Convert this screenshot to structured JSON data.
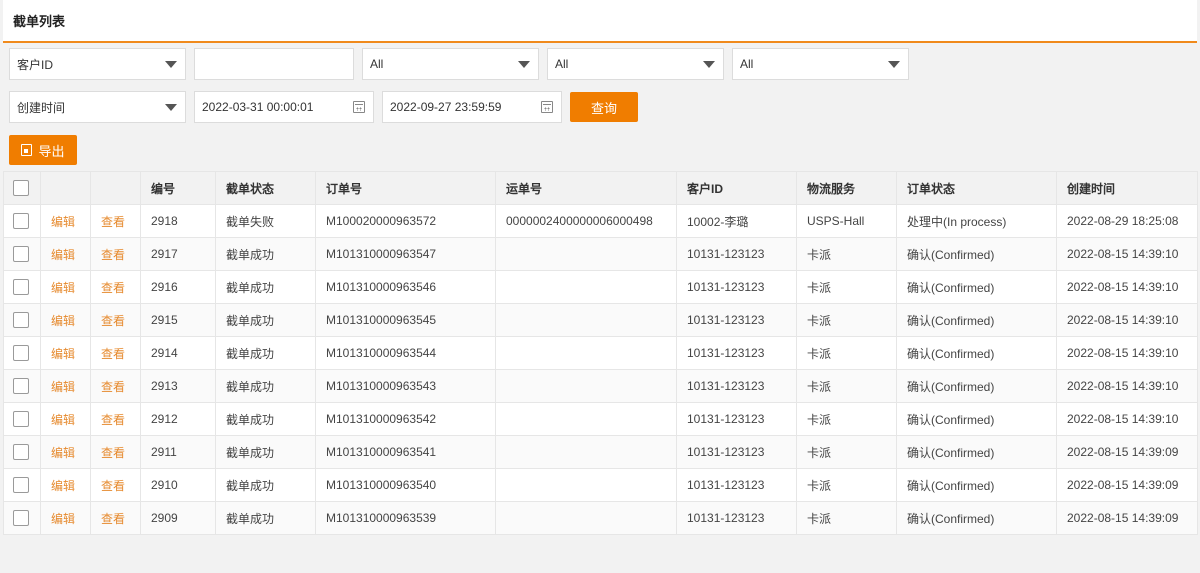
{
  "panel": {
    "title": "截单列表"
  },
  "filters": {
    "row1": {
      "field_select": "客户ID",
      "text_value": "",
      "select2": "All",
      "select3": "All",
      "select4": "All"
    },
    "row2": {
      "date_type": "创建时间",
      "start": "2022-03-31 00:00:01",
      "end": "2022-09-27 23:59:59",
      "query_label": "查询"
    },
    "export_label": "导出"
  },
  "table": {
    "headers": [
      "编号",
      "截单状态",
      "订单号",
      "运单号",
      "客户ID",
      "物流服务",
      "订单状态",
      "创建时间"
    ],
    "edit_label": "编辑",
    "view_label": "查看",
    "rows": [
      [
        "2918",
        "截单失败",
        "M100020000963572",
        "000000240000000600049​8",
        "10002-李璐",
        "USPS-Hall",
        "处理中(In process)",
        "2022-08-29 18:25:08"
      ],
      [
        "2917",
        "截单成功",
        "M101310000963547",
        "",
        "10131-123123",
        "卡派",
        "确认(Confirmed)",
        "2022-08-15 14:39:10"
      ],
      [
        "2916",
        "截单成功",
        "M101310000963546",
        "",
        "10131-123123",
        "卡派",
        "确认(Confirmed)",
        "2022-08-15 14:39:10"
      ],
      [
        "2915",
        "截单成功",
        "M101310000963545",
        "",
        "10131-123123",
        "卡派",
        "确认(Confirmed)",
        "2022-08-15 14:39:10"
      ],
      [
        "2914",
        "截单成功",
        "M101310000963544",
        "",
        "10131-123123",
        "卡派",
        "确认(Confirmed)",
        "2022-08-15 14:39:10"
      ],
      [
        "2913",
        "截单成功",
        "M101310000963543",
        "",
        "10131-123123",
        "卡派",
        "确认(Confirmed)",
        "2022-08-15 14:39:10"
      ],
      [
        "2912",
        "截单成功",
        "M101310000963542",
        "",
        "10131-123123",
        "卡派",
        "确认(Confirmed)",
        "2022-08-15 14:39:10"
      ],
      [
        "2911",
        "截单成功",
        "M101310000963541",
        "",
        "10131-123123",
        "卡派",
        "确认(Confirmed)",
        "2022-08-15 14:39:09"
      ],
      [
        "2910",
        "截单成功",
        "M101310000963540",
        "",
        "10131-123123",
        "卡派",
        "确认(Confirmed)",
        "2022-08-15 14:39:09"
      ],
      [
        "2909",
        "截单成功",
        "M101310000963539",
        "",
        "10131-123123",
        "卡派",
        "确认(Confirmed)",
        "2022-08-15 14:39:09"
      ]
    ]
  },
  "colors": {
    "accent": "#f07d00",
    "link": "#e68a2e"
  }
}
